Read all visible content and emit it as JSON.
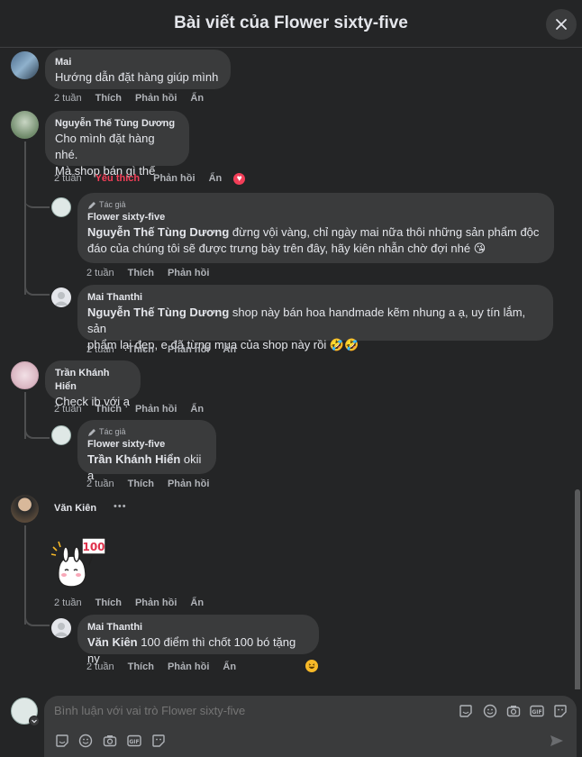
{
  "header": {
    "title": "Bài viết của Flower sixty-five"
  },
  "times": {
    "two_weeks": "2 tuần"
  },
  "actions": {
    "like": "Thích",
    "liked": "Yêu thích",
    "reply": "Phản hồi",
    "hide": "Ẩn"
  },
  "badge": {
    "author": "Tác giả"
  },
  "comments": {
    "c1": {
      "name": "Mai",
      "text": "Hướng dẫn đặt hàng giúp mình"
    },
    "c2": {
      "name": "Nguyễn Thế Tùng Dương",
      "line1": "Cho mình đặt hàng nhé.",
      "line2": "Mà shop bán gì thế"
    },
    "r1": {
      "name": "Flower sixty-five",
      "mention": "Nguyễn Thế Tùng Dương",
      "text1": " đừng vội vàng, chỉ ngày mai nữa thôi những sản phẩm độc",
      "text2": "đáo của chúng tôi sẽ được trưng bày trên đây, hãy kiên nhẫn chờ đợi nhé 😘"
    },
    "r2": {
      "name": "Mai Thanthi",
      "mention": "Nguyễn Thế Tùng Dương",
      "text1": " shop này bán hoa handmade kẽm nhung a ạ, uy tín lắm, sản",
      "text2": "phẩm lại đẹp, e đã từng mua của shop này rồi 🤣🤣"
    },
    "c3": {
      "name": "Trần Khánh Hiển",
      "text": "Check ib với ạ"
    },
    "r3": {
      "name": "Flower sixty-five",
      "mention": "Trần Khánh Hiển",
      "text": " okii ạ"
    },
    "c4": {
      "name": "Văn Kiên",
      "more": "•••",
      "sticker_text": "100"
    },
    "r4": {
      "name": "Mai Thanthi",
      "mention": "Văn Kiên",
      "text": " 100 điểm thì chốt 100 bó tặng ny"
    }
  },
  "composer": {
    "placeholder": "Bình luận với vai trò Flower sixty-five"
  },
  "colors": {
    "background": "#242526",
    "bubble": "#3a3b3c",
    "liked": "#f33e58",
    "muted": "#b0b3b8"
  },
  "icons": [
    "close-icon",
    "pencil-icon",
    "heart-icon",
    "haha-icon",
    "sticker-icon",
    "emoji-icon",
    "camera-icon",
    "gif-icon",
    "send-icon",
    "chevron-down-icon"
  ]
}
